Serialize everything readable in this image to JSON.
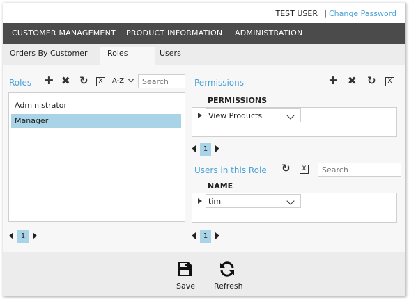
{
  "header": {
    "user_name": "TEST USER",
    "separator": "|",
    "change_password": "Change Password"
  },
  "menu": {
    "items": [
      {
        "label": "CUSTOMER MANAGEMENT"
      },
      {
        "label": "PRODUCT INFORMATION"
      },
      {
        "label": "ADMINISTRATION"
      }
    ]
  },
  "tabs": {
    "items": [
      {
        "label": "Orders By Customer"
      },
      {
        "label": "Roles"
      },
      {
        "label": "Users"
      }
    ],
    "active": "Roles"
  },
  "roles_panel": {
    "title": "Roles",
    "sort_label": "A-Z",
    "search_placeholder": "Search",
    "clear_icon_label": "X",
    "items": [
      {
        "label": "Administrator",
        "selected": false
      },
      {
        "label": "Manager",
        "selected": true
      }
    ],
    "pager": {
      "page": "1"
    }
  },
  "permissions_panel": {
    "title": "Permissions",
    "clear_icon_label": "X",
    "column_header": "PERMISSIONS",
    "rows": [
      {
        "value": "View Products"
      }
    ],
    "pager": {
      "page": "1"
    }
  },
  "users_panel": {
    "title": "Users in this Role",
    "clear_icon_label": "X",
    "search_placeholder": "Search",
    "column_header": "NAME",
    "rows": [
      {
        "value": "tim"
      }
    ],
    "pager": {
      "page": "1"
    }
  },
  "footer": {
    "save_label": "Save",
    "refresh_label": "Refresh"
  },
  "colors": {
    "accent": "#4aa3d9",
    "menu_bg": "#4b4b4b",
    "selection": "#a9d3e6"
  }
}
